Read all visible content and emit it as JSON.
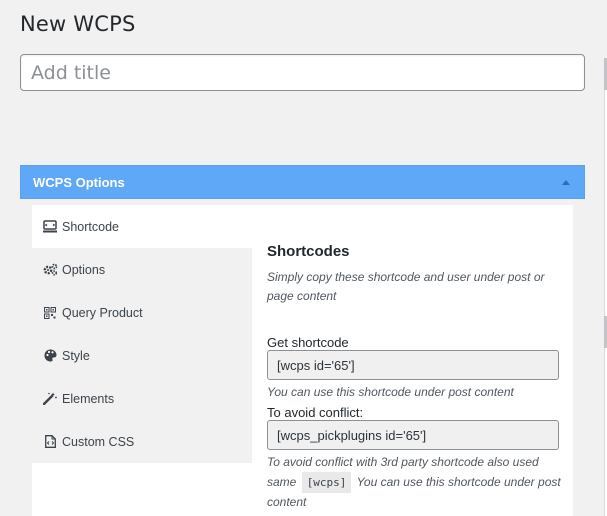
{
  "page": {
    "title": "New WCPS",
    "title_placeholder": "Add title"
  },
  "metabox": {
    "title": "WCPS Options"
  },
  "tabs": [
    {
      "label": "Shortcode",
      "icon": "shortcode-icon"
    },
    {
      "label": "Options",
      "icon": "gears-icon"
    },
    {
      "label": "Query Product",
      "icon": "qrcode-icon"
    },
    {
      "label": "Style",
      "icon": "palette-icon"
    },
    {
      "label": "Elements",
      "icon": "magic-wand-icon"
    },
    {
      "label": "Custom CSS",
      "icon": "css-file-icon"
    }
  ],
  "shortcodes": {
    "heading": "Shortcodes",
    "description": "Simply copy these shortcode and user under post or page content",
    "get_label": "Get shortcode",
    "get_value": "[wcps id='65']",
    "get_hint": "You can use this shortcode under post content",
    "conflict_label": "To avoid conflict:",
    "conflict_value": "[wcps_pickplugins id='65']",
    "conflict_hint_before": "To avoid conflict with 3rd party shortcode also used same",
    "conflict_hint_code": "[wcps]",
    "conflict_hint_after": "You can use this shortcode under post content"
  },
  "colors": {
    "header_bg": "#5fa8f7",
    "page_bg": "#f1f1f1",
    "tab_bg": "#f1f1f1",
    "active_tab_bg": "#ffffff"
  }
}
